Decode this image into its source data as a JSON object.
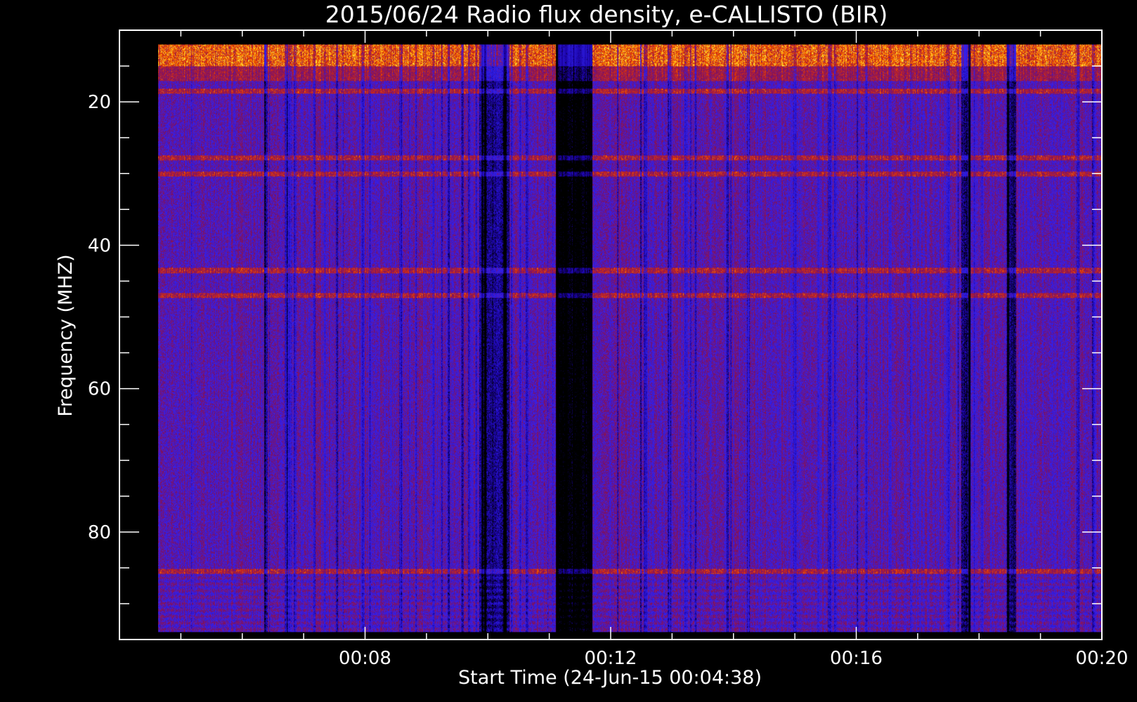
{
  "chart_data": {
    "type": "heatmap",
    "title": "2015/06/24  Radio flux density, e-CALLISTO (BIR)",
    "xlabel": "Start Time (24-Jun-15 00:04:38)",
    "ylabel": "Frequency (MHZ)",
    "x_unit": "minutes after 00:00 UT",
    "x_range": [
      4.0,
      20.0
    ],
    "data_time_range": [
      4.63,
      20.0
    ],
    "y_range": [
      10,
      95
    ],
    "y_reversed": true,
    "data_freq_range": [
      12,
      94
    ],
    "x_ticks": [
      {
        "value": 8,
        "label": "00:08"
      },
      {
        "value": 12,
        "label": "00:12"
      },
      {
        "value": 16,
        "label": "00:16"
      },
      {
        "value": 20,
        "label": "00:20"
      }
    ],
    "x_minor_step": 1,
    "y_ticks": [
      {
        "value": 20,
        "label": "20"
      },
      {
        "value": 40,
        "label": "40"
      },
      {
        "value": 60,
        "label": "60"
      },
      {
        "value": 80,
        "label": "80"
      }
    ],
    "y_minor_step": 5,
    "grid": false,
    "colormap": [
      "#000000",
      "#1a00a0",
      "#2a1ad8",
      "#3a20e8",
      "#7a1060",
      "#9a1a50",
      "#e03000",
      "#ff8800",
      "#ffee40"
    ],
    "background_color": "#000000",
    "axis_color": "#ffffff",
    "quiet_bands": [
      {
        "t_start": 9.85,
        "t_end": 10.35,
        "level": "low"
      },
      {
        "t_start": 11.1,
        "t_end": 11.7,
        "level": "very low"
      },
      {
        "t_start": 18.45,
        "t_end": 18.6,
        "level": "low"
      },
      {
        "t_start": 17.7,
        "t_end": 17.85,
        "level": "low"
      }
    ],
    "bright_bands": [
      {
        "f_start": 12,
        "f_end": 15,
        "level": "high"
      },
      {
        "f_start": 15,
        "f_end": 17,
        "level": "medium"
      }
    ],
    "rfi_lines_mhz": [
      18.5,
      27.8,
      30,
      43.5,
      47,
      85.5
    ]
  }
}
